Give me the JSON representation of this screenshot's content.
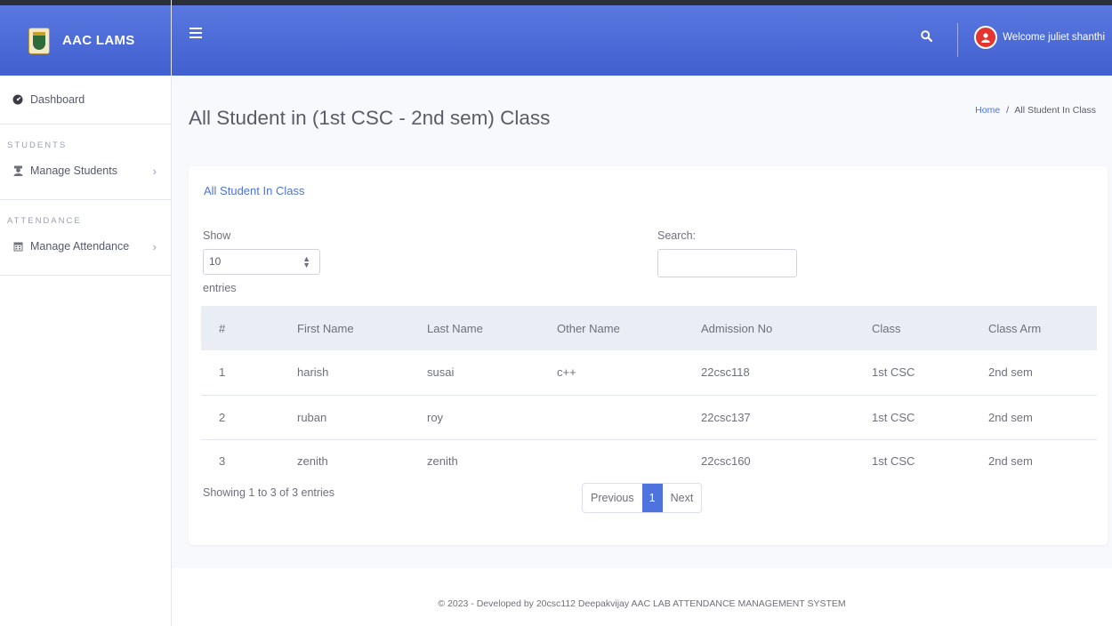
{
  "brand": {
    "name": "AAC LAMS"
  },
  "topbar": {
    "welcome": "Welcome juliet shanthi"
  },
  "sidebar": {
    "dashboard": "Dashboard",
    "heading_students": "STUDENTS",
    "manage_students": "Manage Students",
    "heading_attendance": "ATTENDANCE",
    "manage_attendance": "Manage Attendance"
  },
  "page": {
    "title": "All Student in (1st CSC - 2nd sem) Class",
    "breadcrumb_home": "Home",
    "breadcrumb_sep": "/",
    "breadcrumb_current": "All Student In Class"
  },
  "card": {
    "title": "All Student In Class",
    "show_label": "Show",
    "entries_value": "10",
    "entries_label": "entries",
    "search_label": "Search:",
    "search_value": ""
  },
  "table": {
    "headers": [
      "#",
      "First Name",
      "Last Name",
      "Other Name",
      "Admission No",
      "Class",
      "Class Arm"
    ],
    "rows": [
      [
        "1",
        "harish",
        "susai",
        "c++",
        "22csc118",
        "1st CSC",
        "2nd sem"
      ],
      [
        "2",
        "ruban",
        "roy",
        "",
        "22csc137",
        "1st CSC",
        "2nd sem"
      ],
      [
        "3",
        "zenith",
        "zenith",
        "",
        "22csc160",
        "1st CSC",
        "2nd sem"
      ]
    ]
  },
  "pagination": {
    "showing": "Showing 1 to 3 of 3 entries",
    "previous": "Previous",
    "current": "1",
    "next": "Next"
  },
  "footer": {
    "text": "© 2023 - Developed by 20csc112 Deepakvijay AAC LAB ATTENDANCE MANAGEMENT SYSTEM"
  },
  "colors": {
    "primary": "#4e73df",
    "avatar": "#e3342f"
  }
}
